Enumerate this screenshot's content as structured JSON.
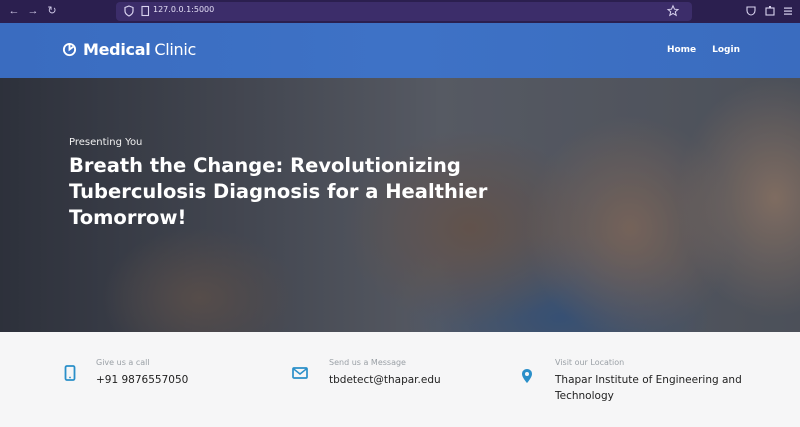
{
  "browser": {
    "url": "127.0.0.1:5000",
    "icons": [
      "back-icon",
      "forward-icon",
      "reload-icon",
      "shield-icon",
      "page-icon",
      "star-icon",
      "pocket-icon",
      "extensions-icon",
      "menu-icon"
    ]
  },
  "header": {
    "brand_bold": "Medical",
    "brand_light": "Clinic",
    "nav": {
      "home": "Home",
      "login": "Login"
    }
  },
  "hero": {
    "subtitle": "Presenting You",
    "title": "Breath the Change: Revolutionizing Tuberculosis Diagnosis for a Healthier Tomorrow!"
  },
  "info": {
    "call": {
      "label": "Give us a call",
      "value": "+91 9876557050"
    },
    "message": {
      "label": "Send us a Message",
      "value": "tbdetect@thapar.edu"
    },
    "location": {
      "label": "Visit our Location",
      "value": "Thapar Institute of Engineering and Technology"
    }
  },
  "colors": {
    "header": "#3e72c6",
    "accent_icon": "#2a8fc9",
    "chrome": "#2b1f4f",
    "info_bg": "#f6f6f7"
  }
}
